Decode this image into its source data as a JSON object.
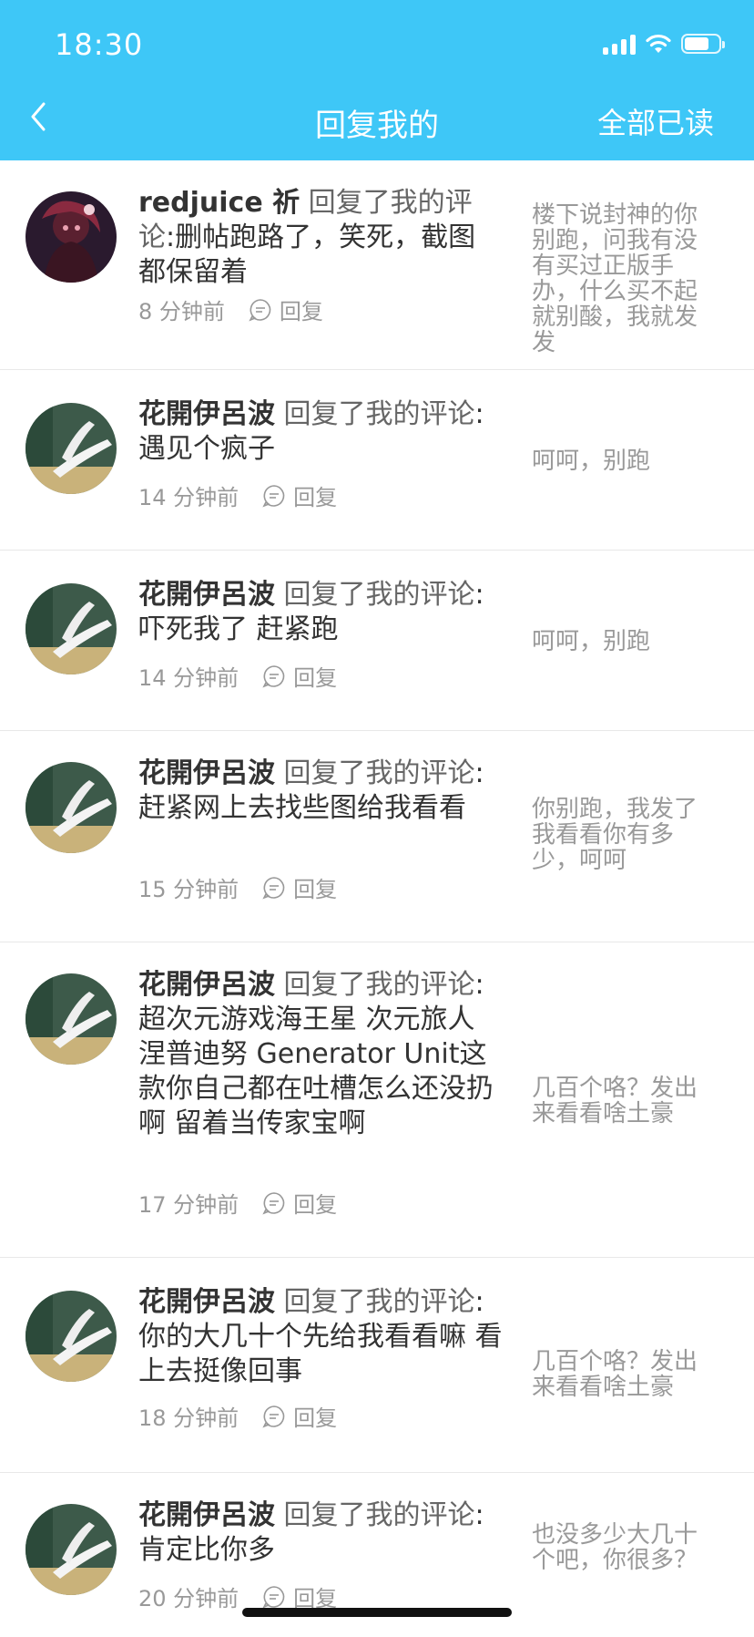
{
  "status_bar": {
    "time": "18:30"
  },
  "nav": {
    "title": "回复我的",
    "action": "全部已读"
  },
  "reply_label": "回复",
  "items": [
    {
      "user": "redjuice 祈",
      "action": " 回复了我的评论",
      "text": ":删帖跑路了，笑死，截图都保留着",
      "time": "8 分钟前",
      "quote": "楼下说封神的你别跑，问我有没有买过正版手办，什么买不起就别酸，我就发发"
    },
    {
      "user": "花開伊呂波",
      "action": " 回复了我的评论",
      "text": ":遇见个疯子",
      "time": "14 分钟前",
      "quote": "呵呵，别跑"
    },
    {
      "user": "花開伊呂波",
      "action": " 回复了我的评论",
      "text": ":吓死我了 赶紧跑",
      "time": "14 分钟前",
      "quote": "呵呵，别跑"
    },
    {
      "user": "花開伊呂波",
      "action": " 回复了我的评论",
      "text": ":赶紧网上去找些图给我看看",
      "time": "15 分钟前",
      "quote": "你别跑，我发了我看看你有多少，呵呵"
    },
    {
      "user": "花開伊呂波",
      "action": " 回复了我的评论",
      "text": ":超次元游戏海王星 次元旅人 涅普迪努 Generator Unit这款你自己都在吐槽怎么还没扔啊 留着当传家宝啊",
      "time": "17 分钟前",
      "quote": "几百个咯？发出来看看啥土豪"
    },
    {
      "user": "花開伊呂波",
      "action": " 回复了我的评论",
      "text": ":你的大几十个先给我看看嘛 看上去挺像回事",
      "time": "18 分钟前",
      "quote": "几百个咯？发出来看看啥土豪"
    },
    {
      "user": "花開伊呂波",
      "action": " 回复了我的评论",
      "text": ":肯定比你多",
      "time": "20 分钟前",
      "quote": "也没多少大几十个吧，你很多？"
    }
  ]
}
